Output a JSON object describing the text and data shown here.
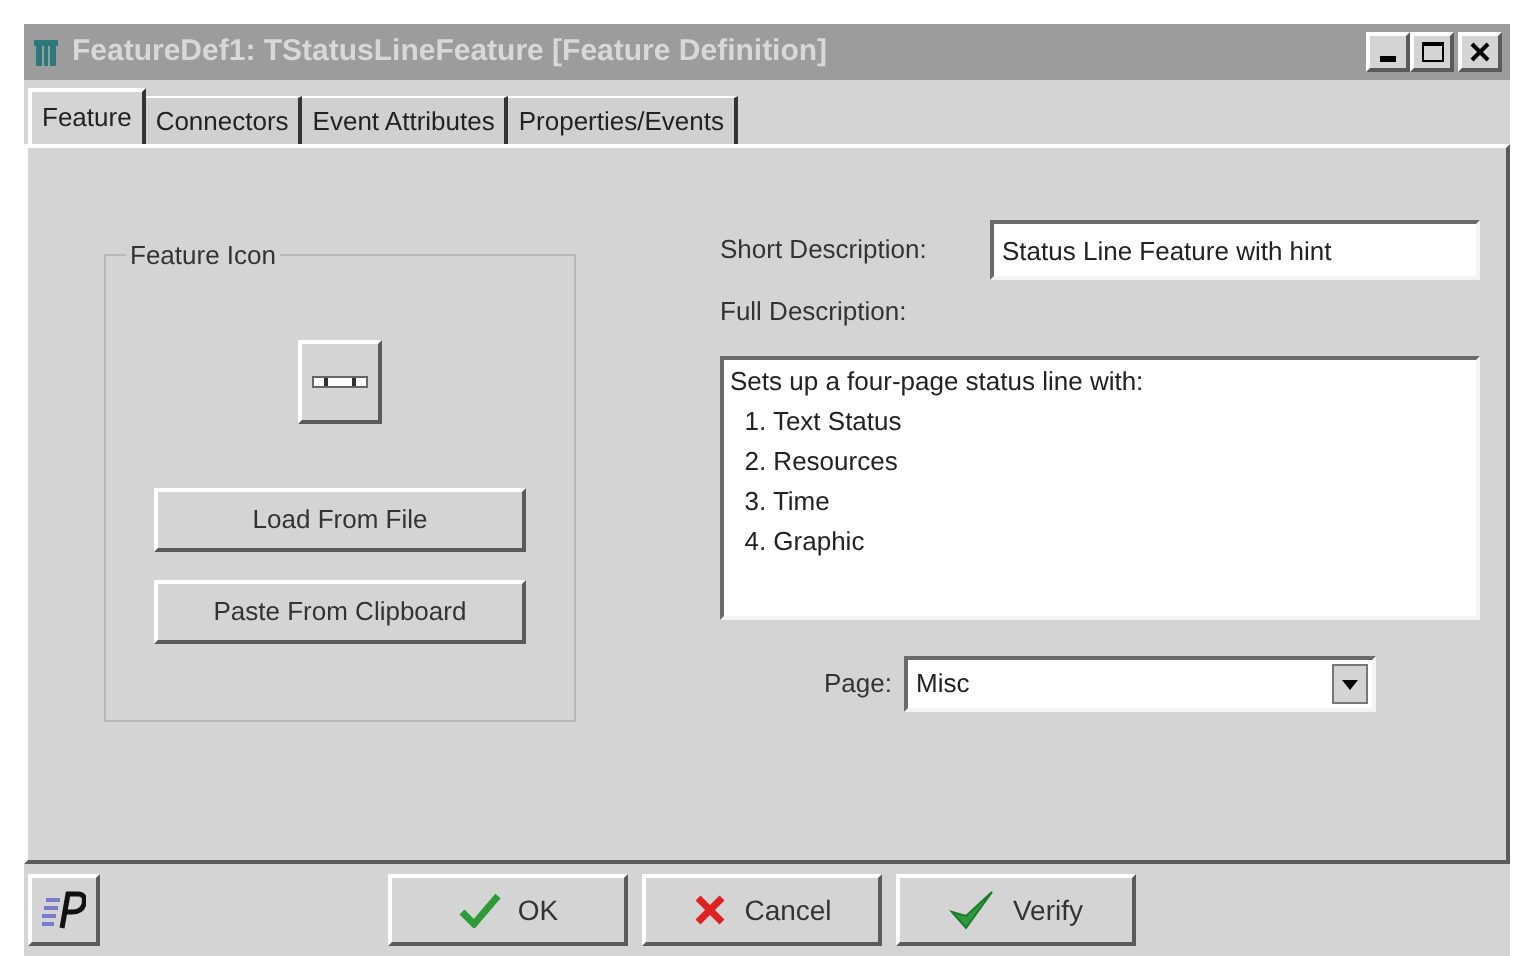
{
  "window": {
    "title": "FeatureDef1: TStatusLineFeature [Feature Definition]"
  },
  "tabs": [
    {
      "label": "Feature",
      "selected": true
    },
    {
      "label": "Connectors",
      "selected": false
    },
    {
      "label": "Event Attributes",
      "selected": false
    },
    {
      "label": "Properties/Events",
      "selected": false
    }
  ],
  "feature_icon": {
    "title": "Feature Icon",
    "buttons": [
      "Load From File",
      "Paste From Clipboard"
    ]
  },
  "short_description": {
    "label": "Short Description:",
    "value": "Status Line Feature with hint"
  },
  "full_description": {
    "label": "Full Description:",
    "lines": [
      "Sets up a four-page status line with:",
      "  1. Text Status",
      "  2. Resources",
      "  3. Time",
      "  4. Graphic"
    ]
  },
  "page": {
    "label": "Page:",
    "value": "Misc"
  },
  "buttons": [
    {
      "kind": "ok",
      "label": "OK"
    },
    {
      "kind": "cancel",
      "label": "Cancel"
    },
    {
      "kind": "verify",
      "label": "Verify"
    }
  ]
}
